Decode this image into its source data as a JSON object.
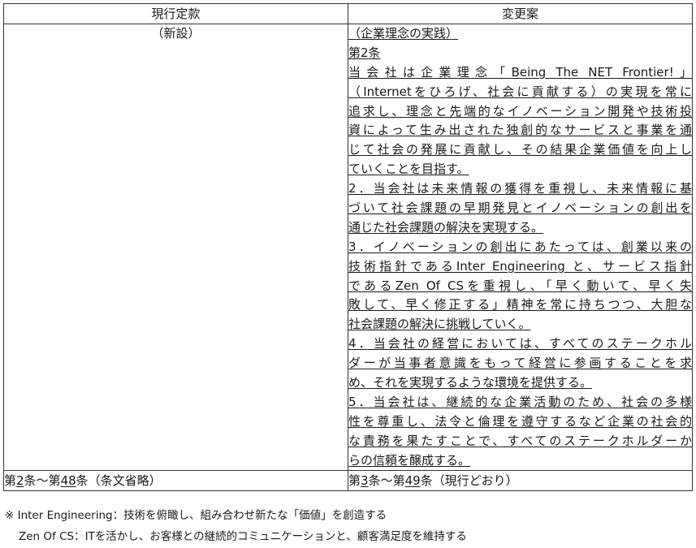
{
  "table": {
    "headers": [
      "現行定款",
      "変更案"
    ],
    "new_cell": "（新設）",
    "right_lines": [
      {
        "text": "（企業理念の実践）",
        "justify": false
      },
      {
        "text": "第2条",
        "justify": false
      },
      {
        "text": "当会社は企業理念「Being The NET Frontier!」",
        "justify": true
      },
      {
        "text": "（Internetをひろげ、社会に貢献する）の実現を常に",
        "justify": true
      },
      {
        "text": "追求し、理念と先端的なイノベーション開発や技術投",
        "justify": true
      },
      {
        "text": "資によって生み出された独創的なサービスと事業を通",
        "justify": true
      },
      {
        "text": "じて社会の発展に貢献し、その結果企業価値を向上し",
        "justify": true
      },
      {
        "text": "ていくことを目指す。",
        "justify": false
      },
      {
        "text": "2．当会社は未来情報の獲得を重視し、未来情報に基",
        "justify": true
      },
      {
        "text": "づいて社会課題の早期発見とイノベーションの創出を",
        "justify": true
      },
      {
        "text": "通じた社会課題の解決を実現する。",
        "justify": false
      },
      {
        "text": "3．イノベーションの創出にあたっては、創業以来の",
        "justify": true
      },
      {
        "text": "技術指針であるInter Engineering と、サービス指針",
        "justify": true
      },
      {
        "text": "であるZen Of CSを重視し、「早く動いて、早く失",
        "justify": true
      },
      {
        "text": "敗して、早く修正する」精神を常に持ちつつ、大胆な",
        "justify": true
      },
      {
        "text": "社会課題の解決に挑戦していく。",
        "justify": false
      },
      {
        "text": "4．当会社の経営においては、すべてのステークホル",
        "justify": true
      },
      {
        "text": "ダーが当事者意識をもって経営に参画することを求",
        "justify": true
      },
      {
        "text": "め、それを実現するような環境を提供する。",
        "justify": false
      },
      {
        "text": "5．当会社は、継続的な企業活動のため、社会の多様",
        "justify": true
      },
      {
        "text": "性を尊重し、法令と倫理を遵守するなど企業の社会的",
        "justify": true
      },
      {
        "text": "な責務を果たすことで、すべてのステークホルダーか",
        "justify": true
      },
      {
        "text": "らの信頼を醸成する。",
        "justify": false
      }
    ],
    "footer_left": {
      "pre": "第",
      "n1": "2",
      "mid": "条～第",
      "n2": "48",
      "post": "条（条文省略）"
    },
    "footer_right": {
      "pre": "第",
      "n1": "3",
      "mid": "条～第",
      "n2": "49",
      "post": "条（現行どおり）"
    }
  },
  "notes": [
    "※ Inter Engineering：技術を俯瞰し、組み合わせ新たな「価値」を創造する",
    "Zen Of CS：ITを活かし、お客様との継続的コミュニケーションと、顧客満足度を維持する"
  ]
}
